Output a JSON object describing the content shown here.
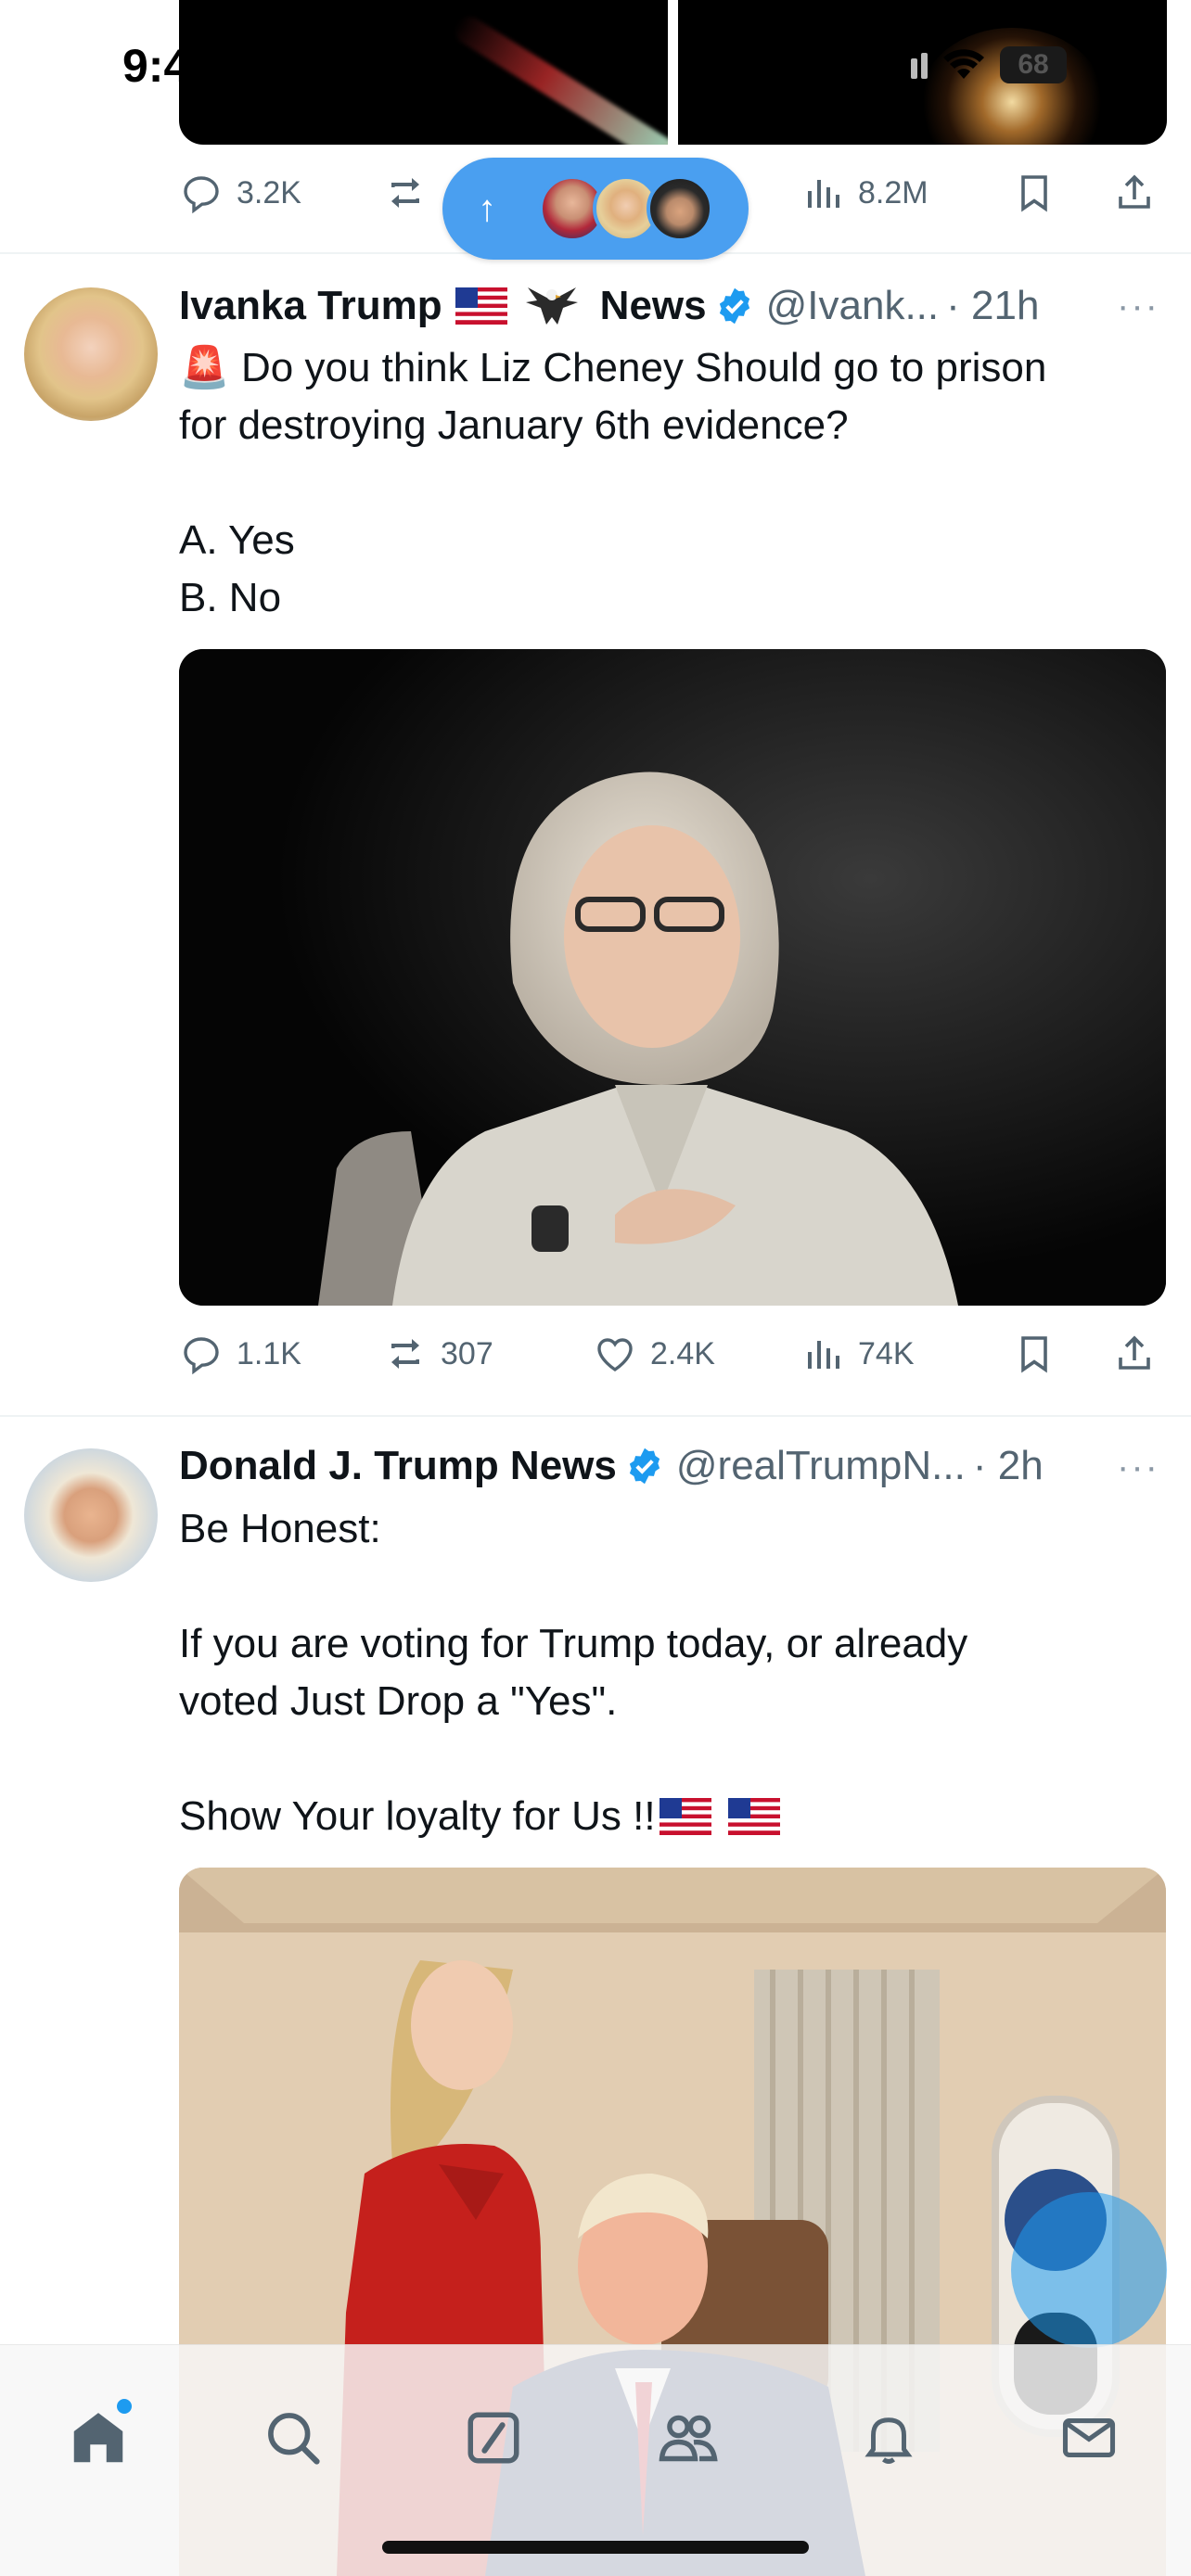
{
  "status_bar": {
    "time": "9:4",
    "battery": "68"
  },
  "top_tweet": {
    "actions": {
      "replies": "3.2K",
      "views": "8.2M"
    }
  },
  "new_posts_pill": {
    "arrow": "↑"
  },
  "tweets": [
    {
      "name": "Ivanka Trump",
      "name_suffix": "News",
      "handle": "@Ivank...",
      "time": "· 21h",
      "more": "···",
      "lines": [
        "🚨 Do you think  Liz Cheney Should  go to prison",
        "for destroying January 6th evidence?",
        "",
        "A.  Yes",
        "B.   No"
      ],
      "actions": {
        "replies": "1.1K",
        "reposts": "307",
        "likes": "2.4K",
        "views": "74K"
      }
    },
    {
      "name": "Donald J. Trump News",
      "handle": "@realTrumpN...",
      "time": "· 2h",
      "more": "···",
      "lines": [
        "Be Honest:",
        "",
        "If you are voting for Trump today, or already",
        "voted Just Drop a \"Yes\".",
        "",
        "Show Your loyalty for Us !!"
      ]
    }
  ],
  "colors": {
    "accent": "#1d9bf0",
    "pill": "#4a9ff0",
    "muted": "#536471",
    "divider": "#eff3f4"
  },
  "icons": [
    "reply-icon",
    "repost-icon",
    "like-icon",
    "views-icon",
    "bookmark-icon",
    "share-icon",
    "verified-icon",
    "home-icon",
    "search-icon",
    "grok-icon",
    "communities-icon",
    "notifications-icon",
    "messages-icon"
  ]
}
